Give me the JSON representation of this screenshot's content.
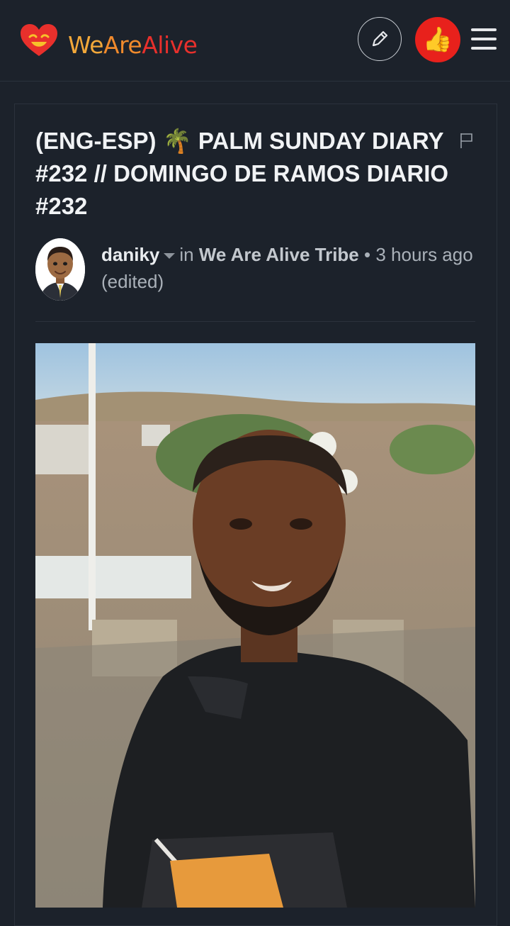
{
  "header": {
    "brand_we": "We",
    "brand_are": "Are",
    "brand_alive": "Alive",
    "pencil_icon": "pencil-icon",
    "like_icon": "thumbs-up-icon",
    "like_glyph": "👍",
    "menu_icon": "hamburger-menu-icon"
  },
  "post": {
    "title": "(ENG-ESP) 🌴 PALM SUNDAY DIARY #232 // DOMINGO DE RAMOS DIARIO #232",
    "author": "daniky",
    "in_label": "in",
    "community": "We Are Alive Tribe",
    "separator": "•",
    "time": "3 hours ago (edited)"
  },
  "colors": {
    "background": "#1c222b",
    "brand_yellow": "#f2a83a",
    "brand_red": "#e8302c",
    "like_button": "#e8211c"
  }
}
